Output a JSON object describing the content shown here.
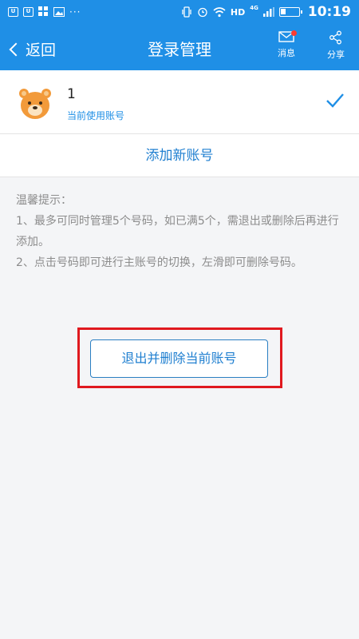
{
  "status_bar": {
    "left_icons": [
      "notification-u-icon",
      "notification-u-icon",
      "app-grid-icon",
      "image-icon",
      "more-dots-icon"
    ],
    "network": "HD",
    "network_type": "4G",
    "time": "10:19",
    "battery_level": 0.3
  },
  "nav": {
    "back_label": "返回",
    "title": "登录管理",
    "message_label": "消息",
    "share_label": "分享",
    "accent_color": "#1f8fe6"
  },
  "account": {
    "name": "1",
    "status": "当前使用账号"
  },
  "add_account_label": "添加新账号",
  "tips": {
    "heading": "温馨提示：",
    "line1": "1、最多可同时管理5个号码，如已满5个，需退出或删除后再进行添加。",
    "line2": "2、点击号码即可进行主账号的切换，左滑即可删除号码。"
  },
  "logout_button_label": "退出并删除当前账号",
  "highlight_color": "#e0191f"
}
